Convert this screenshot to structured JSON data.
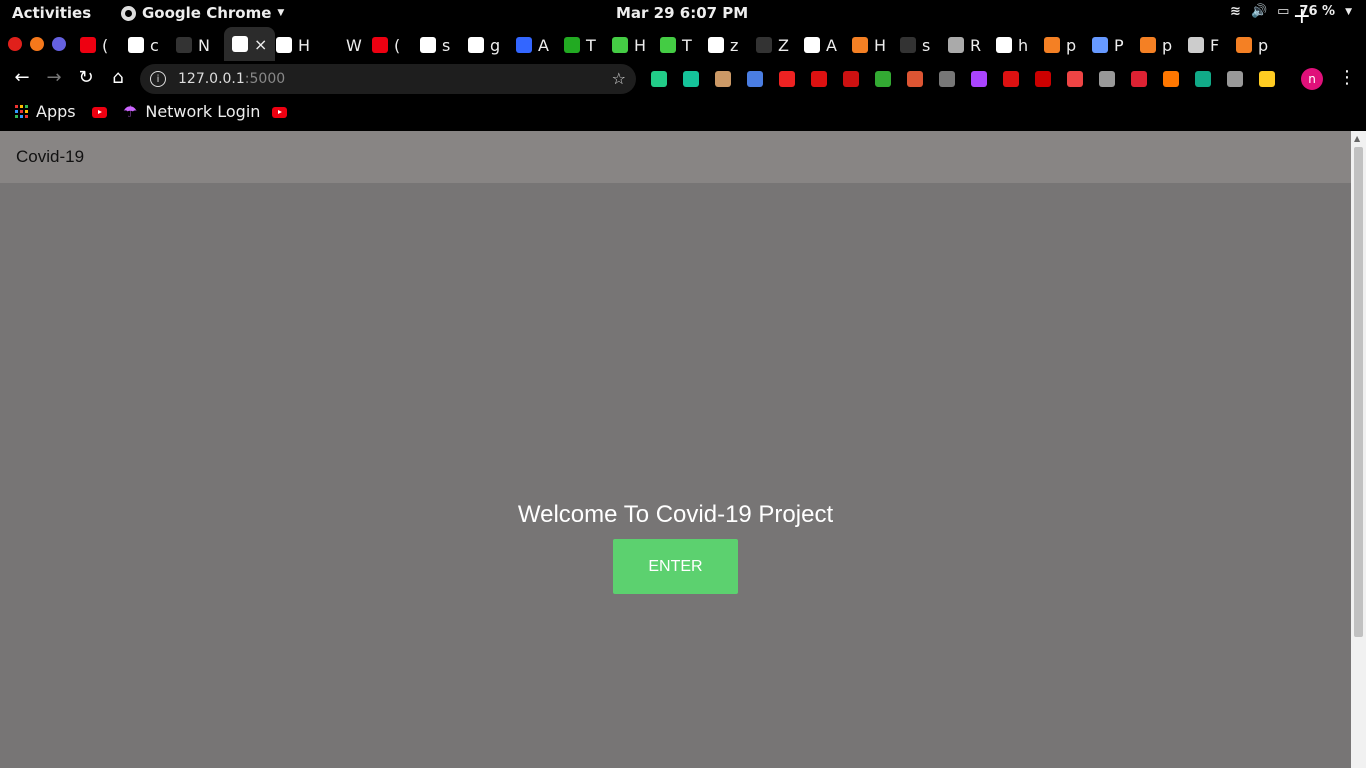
{
  "system_bar": {
    "activities": "Activities",
    "app_name": "Google Chrome",
    "clock": "Mar 29   6:07 PM",
    "battery": "76 %"
  },
  "tabs": [
    {
      "initial": "(",
      "icon": "youtube-icon",
      "color": "#e01"
    },
    {
      "initial": "c",
      "icon": "hexagon-icon",
      "color": "#fff"
    },
    {
      "initial": "N",
      "icon": "github-icon",
      "color": "#333"
    },
    {
      "initial": "×",
      "icon": "globe-icon",
      "color": "#fff",
      "active": true
    },
    {
      "initial": "H",
      "icon": "medium-icon",
      "color": "#fff"
    },
    {
      "initial": "W",
      "icon": "dev-icon",
      "color": "#000"
    },
    {
      "initial": "(",
      "icon": "youtube-icon",
      "color": "#e01"
    },
    {
      "initial": "s",
      "icon": "gmail-icon",
      "color": "#fff"
    },
    {
      "initial": "g",
      "icon": "hexagon-icon",
      "color": "#fff"
    },
    {
      "initial": "A",
      "icon": "card-icon",
      "color": "#36f"
    },
    {
      "initial": "T",
      "icon": "geeks-icon",
      "color": "#2a2"
    },
    {
      "initial": "H",
      "icon": "chart-icon",
      "color": "#4c4"
    },
    {
      "initial": "T",
      "icon": "chart-icon",
      "color": "#4c4"
    },
    {
      "initial": "z",
      "icon": "google-icon",
      "color": "#fff"
    },
    {
      "initial": "Z",
      "icon": "github-icon",
      "color": "#333"
    },
    {
      "initial": "A",
      "icon": "medium-icon",
      "color": "#fff"
    },
    {
      "initial": "H",
      "icon": "stackoverflow-icon",
      "color": "#f48024"
    },
    {
      "initial": "s",
      "icon": "github-icon",
      "color": "#333"
    },
    {
      "initial": "R",
      "icon": "react-icon",
      "color": "#aaa"
    },
    {
      "initial": "h",
      "icon": "google-icon",
      "color": "#fff"
    },
    {
      "initial": "p",
      "icon": "stackoverflow-icon",
      "color": "#f48024"
    },
    {
      "initial": "P",
      "icon": "python-icon",
      "color": "#69f"
    },
    {
      "initial": "p",
      "icon": "stackoverflow-icon",
      "color": "#f48024"
    },
    {
      "initial": "F",
      "icon": "flask-icon",
      "color": "#ccc"
    },
    {
      "initial": "p",
      "icon": "stackoverflow-icon",
      "color": "#f48024"
    }
  ],
  "omnibox": {
    "host": "127.0.0.1",
    "port": ":5000"
  },
  "extensions": [
    {
      "name": "ext-mail-icon",
      "color": "#2c8"
    },
    {
      "name": "ext-grammarly-icon",
      "color": "#15c39a"
    },
    {
      "name": "ext-cookie-icon",
      "color": "#c96"
    },
    {
      "name": "ext-translate-icon",
      "color": "#4a7de2"
    },
    {
      "name": "ext-flag-icon",
      "color": "#e22"
    },
    {
      "name": "ext-yab-icon",
      "color": "#d11"
    },
    {
      "name": "ext-block-icon",
      "color": "#c11"
    },
    {
      "name": "ext-windows-icon",
      "color": "#3a3"
    },
    {
      "name": "ext-office-icon",
      "color": "#d53"
    },
    {
      "name": "ext-bulb-icon",
      "color": "#777"
    },
    {
      "name": "ext-color-icon",
      "color": "#a4f"
    },
    {
      "name": "ext-book-icon",
      "color": "#d11"
    },
    {
      "name": "ext-abp-icon",
      "color": "#c00"
    },
    {
      "name": "ext-video-icon",
      "color": "#e44"
    },
    {
      "name": "ext-chat-icon",
      "color": "#999"
    },
    {
      "name": "ext-spider-icon",
      "color": "#d23"
    },
    {
      "name": "ext-fire-icon",
      "color": "#f70"
    },
    {
      "name": "ext-sheet-icon",
      "color": "#1a8"
    },
    {
      "name": "ext-shield-icon",
      "color": "#999"
    },
    {
      "name": "ext-flipkart-icon",
      "color": "#fc2"
    }
  ],
  "profile_initial": "n",
  "bookmarks": {
    "apps": "Apps",
    "network_login": "Network Login"
  },
  "page": {
    "brand": "Covid-19",
    "welcome": "Welcome To Covid-19 Project",
    "enter_button": "ENTER",
    "accent": "#5cd16f",
    "background": "#777575"
  }
}
